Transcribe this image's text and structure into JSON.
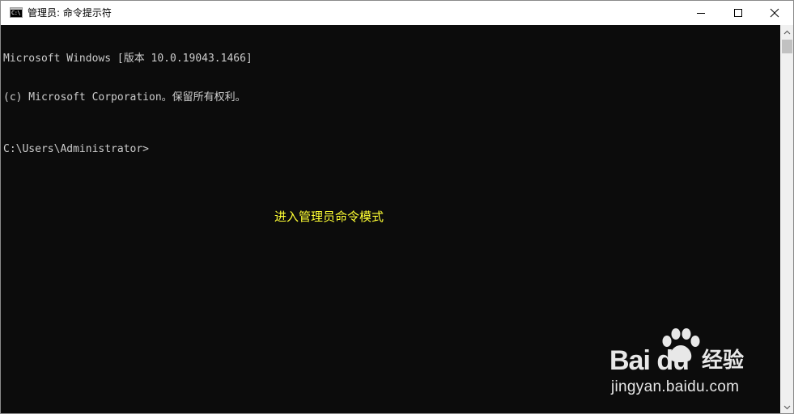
{
  "window": {
    "title": "管理员: 命令提示符",
    "app_icon_text": "C:\\"
  },
  "console": {
    "line1": "Microsoft Windows [版本 10.0.19043.1466]",
    "line2": "(c) Microsoft Corporation。保留所有权利。",
    "prompt": "C:\\Users\\Administrator>"
  },
  "caption": "进入管理员命令模式",
  "watermark": {
    "brand_text": "Bai du",
    "brand_cn": "经验",
    "url": "jingyan.baidu.com"
  },
  "colors": {
    "console_bg": "#0c0c0c",
    "console_text": "#cccccc",
    "caption": "#ffff33",
    "titlebar": "#ffffff"
  },
  "icons": [
    "cmd-app-icon",
    "minimize-icon",
    "maximize-icon",
    "close-icon",
    "scroll-up-icon",
    "scroll-down-icon",
    "baidu-paw-icon"
  ]
}
